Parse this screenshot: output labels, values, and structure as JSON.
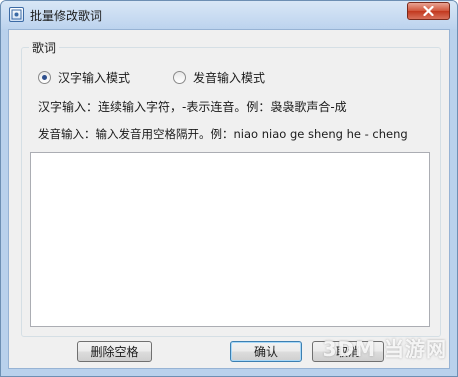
{
  "window": {
    "title": "批量修改歌词"
  },
  "group": {
    "title": "歌词"
  },
  "radios": [
    {
      "label": "汉字输入模式",
      "checked": true
    },
    {
      "label": "发音输入模式",
      "checked": false
    }
  ],
  "hints": {
    "hanzi": "汉字输入：连续输入字符，-表示连音。例：袅袅歌声合-成",
    "pinyin": "发音输入：输入发音用空格隔开。例：niao niao ge sheng he - cheng"
  },
  "lyrics": {
    "value": ""
  },
  "buttons": {
    "remove_spaces": "删除空格",
    "ok": "确认",
    "cancel": "取消"
  },
  "watermark": "3DM 当游网",
  "colors": {
    "title_bar": "#bcd3ee",
    "close_button": "#c2381e",
    "client_bg": "#f0f0f0",
    "radio_dot": "#2d4f8e"
  }
}
